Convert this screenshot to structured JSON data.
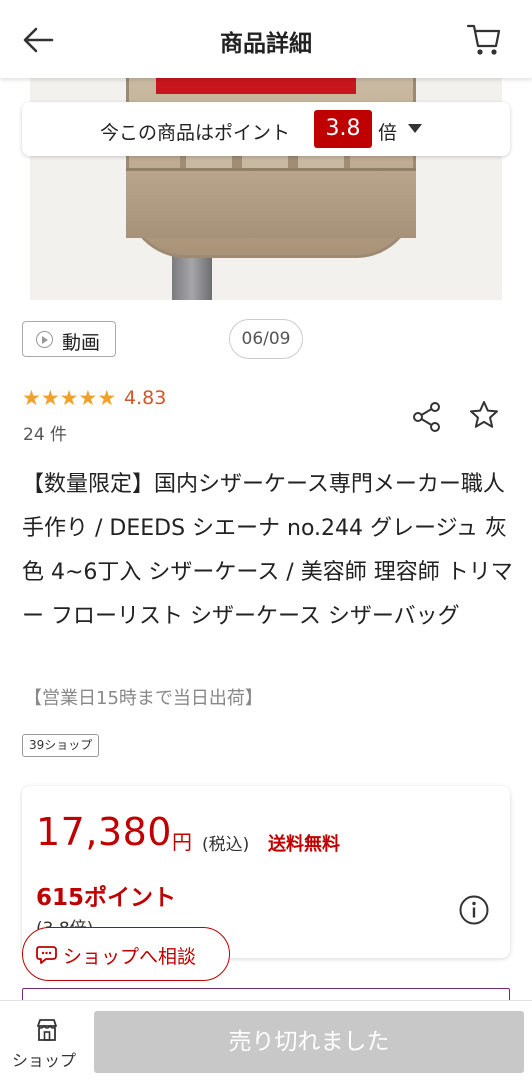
{
  "header": {
    "title": "商品詳細",
    "back_icon": "arrow-left-icon",
    "cart_icon": "cart-icon"
  },
  "point_banner": {
    "text": "今この商品はポイント",
    "multiplier": "3.8",
    "suffix": "倍"
  },
  "media": {
    "video_label": "動画",
    "page_indicator": "06/09"
  },
  "rating": {
    "stars": [
      "★",
      "★",
      "★",
      "★",
      "★"
    ],
    "value": "4.83",
    "count": "24 件"
  },
  "product": {
    "title": "【数量限定】国内シザーケース専門メーカー職人手作り / DEEDS シエーナ no.244 グレージュ 灰色 4~6丁入 シザーケース / 美容師 理容師 トリマー フローリスト シザーケース シザーバッグ",
    "shipping_note": "【営業日15時まで当日出荷】",
    "shop_tag": "39ショップ"
  },
  "price": {
    "amount": "17,380",
    "unit": "円",
    "tax": "(税込)",
    "shipping": "送料無料",
    "points": "615ポイント",
    "points_sub": "(3.8倍)"
  },
  "consult": {
    "label": "ショップへ相談"
  },
  "bottom": {
    "shop_label": "ショップ",
    "sold_out": "売り切れました"
  },
  "colors": {
    "accent_red": "#bf0000",
    "star": "#f0a12a",
    "rating_text": "#d4542a",
    "disabled": "#c8c8c8"
  }
}
